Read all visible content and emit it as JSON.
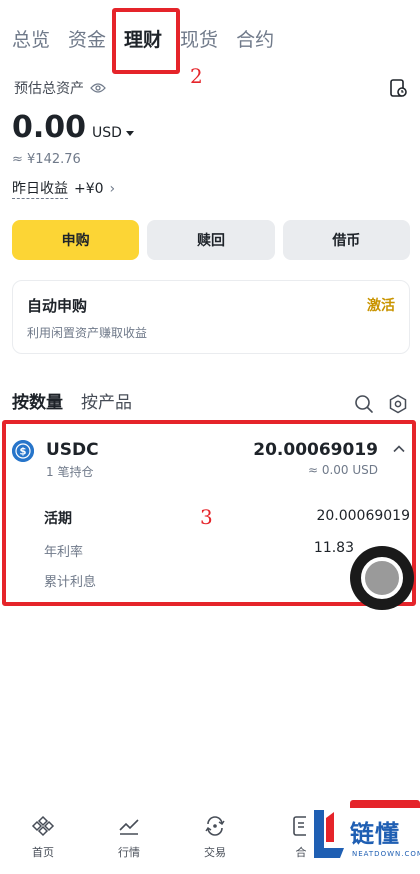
{
  "top_tabs": [
    "总览",
    "资金",
    "理财",
    "现货",
    "合约"
  ],
  "annotations": {
    "tab_step": "2",
    "card_step": "3"
  },
  "estimated": {
    "label": "预估总资产",
    "value": "0.00",
    "unit": "USD",
    "approx": "≈ ¥142.76"
  },
  "yesterday": {
    "label": "昨日收益",
    "value": "+¥0"
  },
  "actions": {
    "subscribe": "申购",
    "redeem": "赎回",
    "borrow": "借币"
  },
  "auto_subscribe": {
    "title": "自动申购",
    "subtitle": "利用闲置资产赚取收益",
    "action": "激活"
  },
  "sub_tabs": {
    "by_quantity": "按数量",
    "by_product": "按产品"
  },
  "asset": {
    "coin": "USDC",
    "holdings": "1 笔持仓",
    "amount": "20.00069019",
    "usd": "≈ 0.00 USD",
    "details": {
      "flexible_label": "活期",
      "flexible_value": "20.00069019",
      "apr_label": "年利率",
      "apr_value": "11.83",
      "interest_label": "累计利息"
    }
  },
  "bottom_nav": {
    "home": "首页",
    "markets": "行情",
    "trade": "交易",
    "more": "合"
  },
  "brand": {
    "name": "链懂",
    "sub": "NEATDOWN.COM"
  },
  "colors": {
    "accent": "#fcd535",
    "annotation_red": "#e5242a",
    "activate": "#c99400",
    "usdc": "#2775ca"
  }
}
